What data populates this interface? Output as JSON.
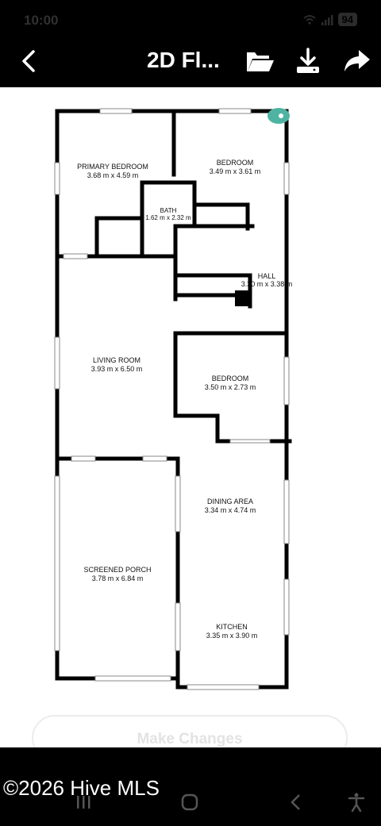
{
  "status_bar": {
    "time": "10:00",
    "battery": "94"
  },
  "top_bar": {
    "title": "2D Fl..."
  },
  "floor_plan": {
    "rooms": [
      {
        "name": "PRIMARY BEDROOM",
        "size": "3.68 m x 4.59 m"
      },
      {
        "name": "BEDROOM",
        "size": "3.49 m x 3.61 m"
      },
      {
        "name": "BATH",
        "size": "1.62 m x 2.32 m"
      },
      {
        "name": "HALL",
        "size": "3.30 m x 3.38 m"
      },
      {
        "name": "LIVING ROOM",
        "size": "3.93 m x 6.50 m"
      },
      {
        "name": "BEDROOM",
        "size": "3.50 m x 2.73 m"
      },
      {
        "name": "DINING AREA",
        "size": "3.34 m x 4.74 m"
      },
      {
        "name": "SCREENED PORCH",
        "size": "3.78 m x 6.84 m"
      },
      {
        "name": "KITCHEN",
        "size": "3.35 m x 3.90 m"
      }
    ]
  },
  "actions": {
    "make_changes": "Make Changes"
  },
  "footer": {
    "copyright": "©2026 Hive MLS"
  },
  "colors": {
    "background": "#000000",
    "plan_background": "#ffffff",
    "accent": "#4fb3a2"
  }
}
